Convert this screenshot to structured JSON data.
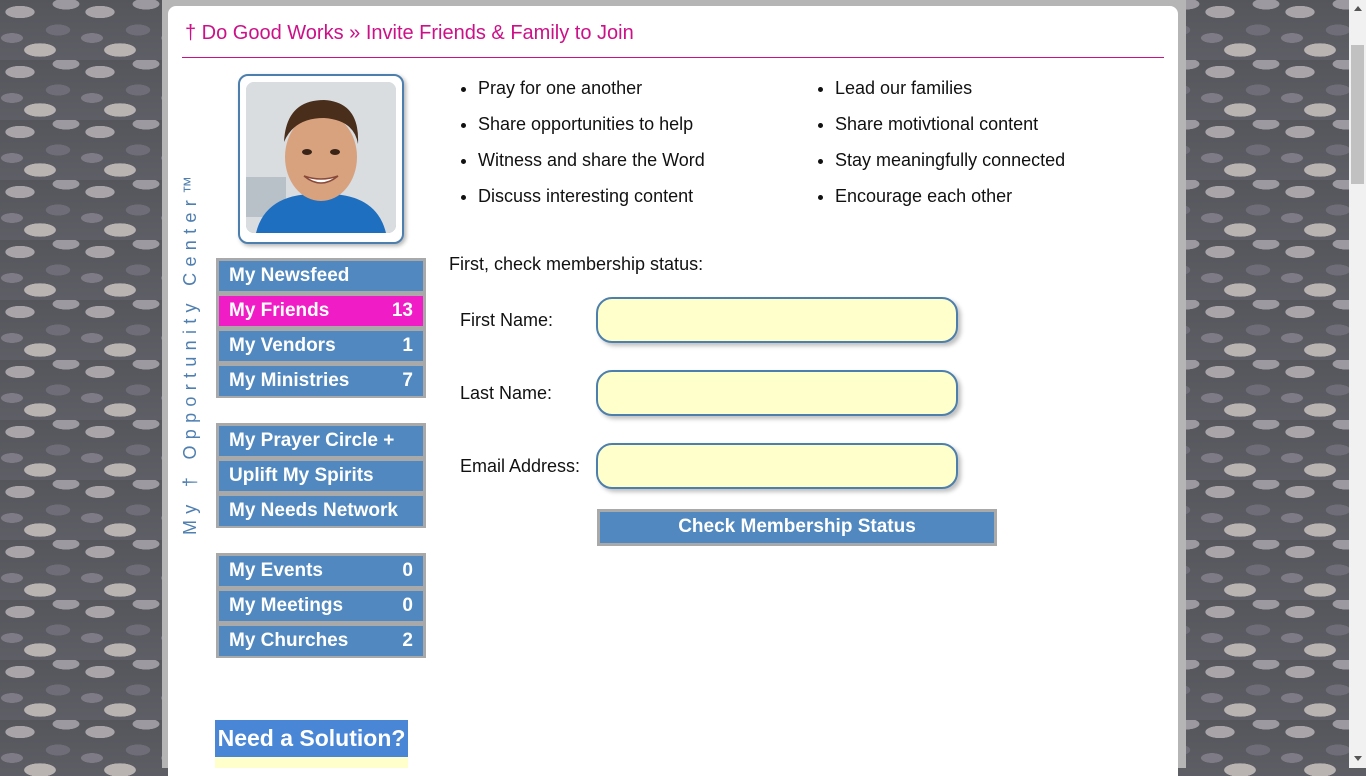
{
  "page": {
    "title": "† Do Good Works » Invite Friends & Family to Join",
    "vertical_brand": "My † Opportunity Center™"
  },
  "colors": {
    "accent_magenta": "#cc1188",
    "nav_blue": "#5088bf",
    "nav_active": "#f01dc6",
    "input_fill": "#ffffcc"
  },
  "profile": {
    "avatar_icon": "user-photo"
  },
  "nav": {
    "group1": [
      {
        "label": "My Newsfeed",
        "count": ""
      },
      {
        "label": "My Friends",
        "count": "13"
      },
      {
        "label": "My Vendors",
        "count": "1"
      },
      {
        "label": "My Ministries",
        "count": "7"
      }
    ],
    "group2": [
      {
        "label": "My Prayer Circle +",
        "count": ""
      },
      {
        "label": "Uplift My Spirits",
        "count": ""
      },
      {
        "label": "My Needs Network",
        "count": ""
      }
    ],
    "group3": [
      {
        "label": "My Events",
        "count": "0"
      },
      {
        "label": "My Meetings",
        "count": "0"
      },
      {
        "label": "My Churches",
        "count": "2"
      }
    ]
  },
  "bullets": {
    "left": [
      "Pray for one another",
      "Share opportunities to help",
      "Witness and share the Word",
      "Discuss interesting content"
    ],
    "right": [
      "Lead our families",
      "Share motivtional content",
      "Stay meaningfully connected",
      "Encourage each other"
    ]
  },
  "form": {
    "intro": "First, check membership status:",
    "first_name_label": "First Name:",
    "first_name_value": "",
    "last_name_label": "Last Name:",
    "last_name_value": "",
    "email_label": "Email Address:",
    "email_value": "",
    "submit_label": "Check Membership Status"
  },
  "solution": {
    "label": "Need a Solution?"
  }
}
